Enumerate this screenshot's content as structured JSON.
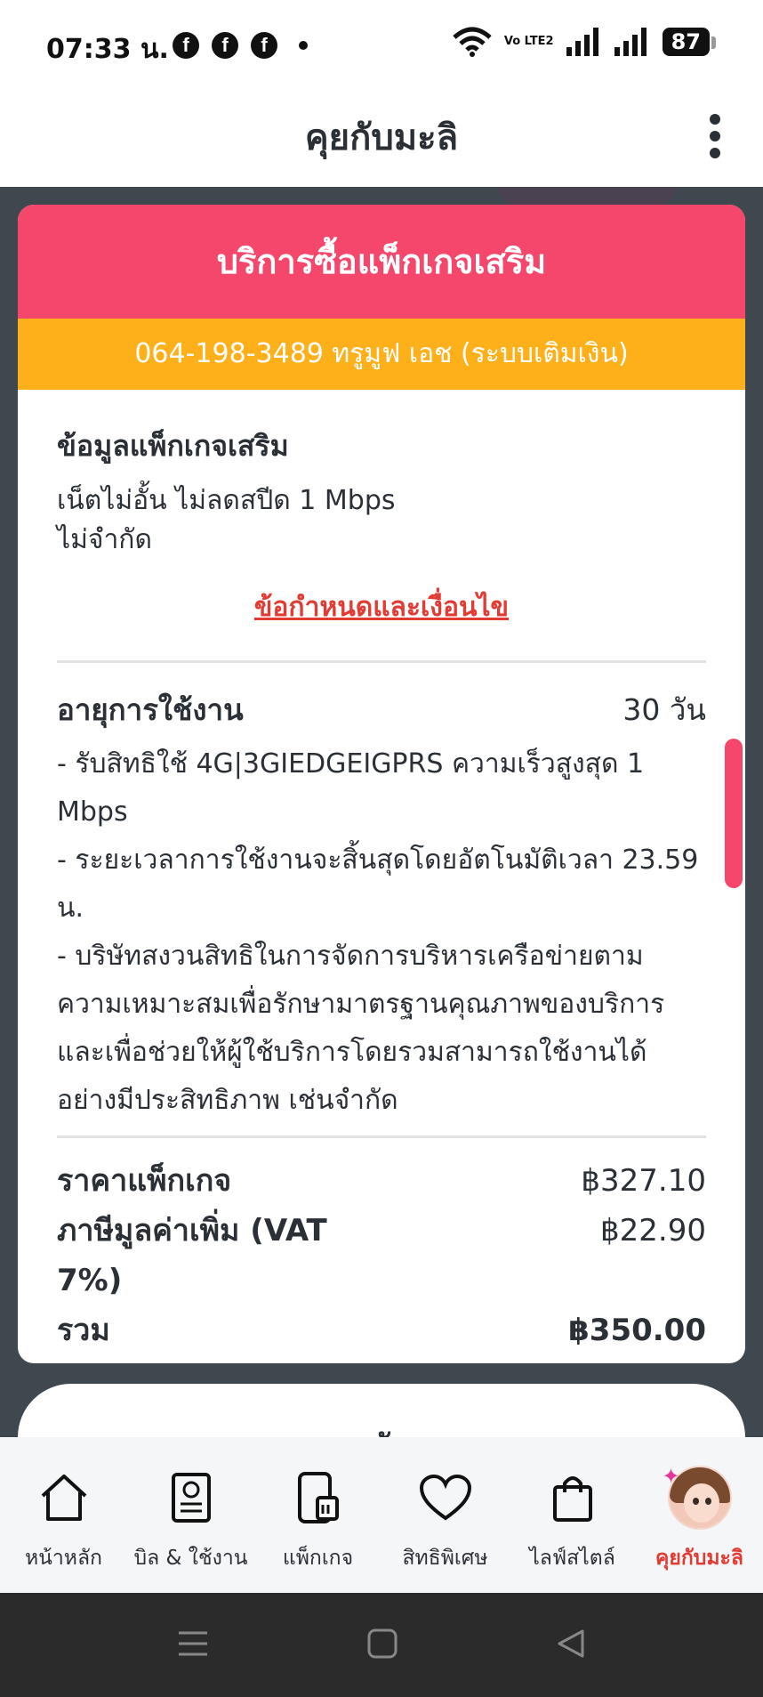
{
  "status": {
    "time": "07:33 น.",
    "notif_icons": [
      "f",
      "f",
      "f"
    ],
    "volte": "Vo LTE2",
    "battery": "87"
  },
  "header": {
    "title": "คุยกับมะลิ"
  },
  "card": {
    "title": "บริการซื้อแพ็กเกจเสริม",
    "number_line": "064-198-3489 ทรูมูฟ เอช (ระบบเติมเงิน)",
    "info_title": "ข้อมูลแพ็กเกจเสริม",
    "info_lines": [
      "เน็ตไม่อั้น ไม่ลดสปีด 1 Mbps",
      "ไม่จำกัด"
    ],
    "terms": "ข้อกำหนดและเงื่อนไข",
    "validity_label": "อายุการใช้งาน",
    "validity_value": "30 วัน",
    "description": "- รับสิทธิใช้ 4G|3GIEDGEIGPRS ความเร็วสูงสุด 1 Mbps\n- ระยะเวลาการใช้งานจะสิ้นสุดโดยอัตโนมัติเวลา 23.59 น.\n- บริษัทสงวนสิทธิในการจัดการบริหารเครือข่ายตามความเหมาะสมเพื่อรักษามาตรฐานคุณภาพของบริการและเพื่อช่วยให้ผู้ใช้บริการโดยรวมสามารถใช้งานได้อย่างมีประสิทธิภาพ เช่นจำกัด",
    "price_label": "ราคาแพ็กเกจ",
    "price_value": "฿327.10",
    "vat_label": "ภาษีมูลค่าเพิ่ม (VAT 7%)",
    "vat_value": "฿22.90",
    "total_label": "รวม",
    "total_value": "฿350.00"
  },
  "back_button": "กลับ",
  "bottom_nav": [
    {
      "label": "หน้าหลัก",
      "icon": "home-icon"
    },
    {
      "label": "บิล & ใช้งาน",
      "icon": "bill-icon"
    },
    {
      "label": "แพ็กเกจ",
      "icon": "package-icon"
    },
    {
      "label": "สิทธิพิเศษ",
      "icon": "heart-icon"
    },
    {
      "label": "ไลฟ์สไตล์",
      "icon": "shopping-bag-icon"
    },
    {
      "label": "คุยกับมะลิ",
      "icon": "mali-avatar-icon",
      "active": true
    }
  ],
  "colors": {
    "primary": "#f5476b",
    "accent": "#fdb019",
    "link": "#e23b34",
    "backdrop": "#3f474f"
  }
}
